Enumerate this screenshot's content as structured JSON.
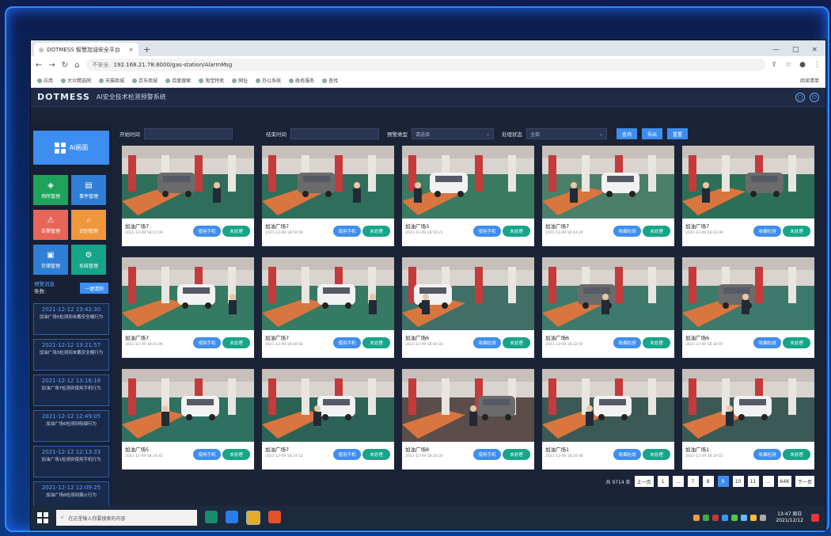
{
  "browser": {
    "tab_title": "DOTMESS 智慧加油安全平台",
    "url_security": "不安全",
    "url": "192.168.21.78:8000/gas-station/AlarmMsg",
    "bookmarks": [
      "应用",
      "大众精选网",
      "天猫商城",
      "京东商城",
      "百度搜索",
      "淘宝特卖",
      "网址",
      "办公系统",
      "政务服务",
      "查找"
    ],
    "reading_list": "阅读清单"
  },
  "app": {
    "logo": "DOTMESS",
    "title": "AI安全技术检测预警系统"
  },
  "sidebar": {
    "main_item": "AI画面",
    "items": [
      {
        "label": "场所管理",
        "color": "#1fa35a",
        "icon": "cube-icon"
      },
      {
        "label": "事件管理",
        "color": "#2f7fd6",
        "icon": "doc-icon"
      },
      {
        "label": "告警管理",
        "color": "#e8655a",
        "icon": "alert-icon"
      },
      {
        "label": "识别管理",
        "color": "#f0963c",
        "icon": "search-icon"
      },
      {
        "label": "存储管理",
        "color": "#2f7fd6",
        "icon": "disk-icon"
      },
      {
        "label": "系统管理",
        "color": "#16a58a",
        "icon": "gear-icon"
      }
    ],
    "alarm_title": "预警消息",
    "alarm_count": "条数:",
    "clear_button": "一键清除",
    "alarms": [
      {
        "time": "2021-12-12 13:42:30",
        "desc": "加油广场5检测到未戴安全帽行为"
      },
      {
        "time": "2021-12-12 13:21:57",
        "desc": "加油广场3检测到未戴安全帽行为"
      },
      {
        "time": "2021-12-12 13:16:18",
        "desc": "加油广场7检测到使用手机行为"
      },
      {
        "time": "2021-12-12 12:49:05",
        "desc": "加油广场6检测到吸烟行为"
      },
      {
        "time": "2021-12-12 12:13:33",
        "desc": "加油广场1检测到使用手机行为"
      },
      {
        "time": "2021-12-12 12:09:25",
        "desc": "加油广场8检测到烟火行为"
      }
    ]
  },
  "filters": {
    "start_label": "开始时间",
    "end_label": "结束时间",
    "type_label": "预警类型",
    "type_placeholder": "请选择",
    "status_label": "处理状态",
    "status_value": "全部",
    "buttons": [
      "查询",
      "导出",
      "重置"
    ]
  },
  "cards": [
    {
      "title": "加油广场7",
      "time": "2021-12-09 18:51:09",
      "tag": "使用手机",
      "status": "未处理",
      "scene": 0
    },
    {
      "title": "加油广场7",
      "time": "2021-12-09 18:50:59",
      "tag": "使用手机",
      "status": "未处理",
      "scene": 0
    },
    {
      "title": "加油广场3",
      "time": "2021-12-09 18:50:21",
      "tag": "使用手机",
      "status": "未处理",
      "scene": 1
    },
    {
      "title": "加油广场7",
      "time": "2021-12-09 18:44:20",
      "tag": "吸烟检测",
      "status": "未处理",
      "scene": 2
    },
    {
      "title": "加油广场7",
      "time": "2021-12-09 18:43:09",
      "tag": "吸烟检测",
      "status": "未处理",
      "scene": 3
    },
    {
      "title": "加油广场7",
      "time": "2021-12-09 18:41:09",
      "tag": "使用手机",
      "status": "未处理",
      "scene": 4
    },
    {
      "title": "加油广场7",
      "time": "2021-12-09 18:40:56",
      "tag": "使用手机",
      "status": "未处理",
      "scene": 4
    },
    {
      "title": "加油广场6",
      "time": "2021-12-09 18:40:33",
      "tag": "吸烟检测",
      "status": "未处理",
      "scene": 5
    },
    {
      "title": "加油广场6",
      "time": "2021-12-09 18:32:07",
      "tag": "吸烟检测",
      "status": "未处理",
      "scene": 6
    },
    {
      "title": "加油广场6",
      "time": "2021-12-09 18:30:07",
      "tag": "吸烟检测",
      "status": "未处理",
      "scene": 6
    },
    {
      "title": "加油广场5",
      "time": "2021-12-09 18:24:45",
      "tag": "使用手机",
      "status": "未处理",
      "scene": 7
    },
    {
      "title": "加油广场7",
      "time": "2021-12-09 18:24:11",
      "tag": "使用手机",
      "status": "未处理",
      "scene": 8
    },
    {
      "title": "加油广场8",
      "time": "2021-12-09 18:20:20",
      "tag": "使用手机",
      "status": "未处理",
      "scene": 9
    },
    {
      "title": "加油广场1",
      "time": "2021-12-09 18:20:44",
      "tag": "吸烟检测",
      "status": "未处理",
      "scene": 10
    },
    {
      "title": "加油广场1",
      "time": "2021-12-09 18:19:51",
      "tag": "吸烟检测",
      "status": "未处理",
      "scene": 10
    }
  ],
  "pager": {
    "total": "共 9714 条",
    "prev": "上一页",
    "pages": [
      "1",
      "...",
      "7",
      "8",
      "9",
      "10",
      "11",
      "...",
      "648"
    ],
    "active": "9",
    "next": "下一页"
  },
  "taskbar": {
    "search_placeholder": "在这里输入你要搜索的内容",
    "time": "13:47 周日",
    "date": "2021/12/12"
  },
  "colors": {
    "accent": "#3d8ef0",
    "status_green": "#17a589",
    "panel": "#1b2436"
  }
}
